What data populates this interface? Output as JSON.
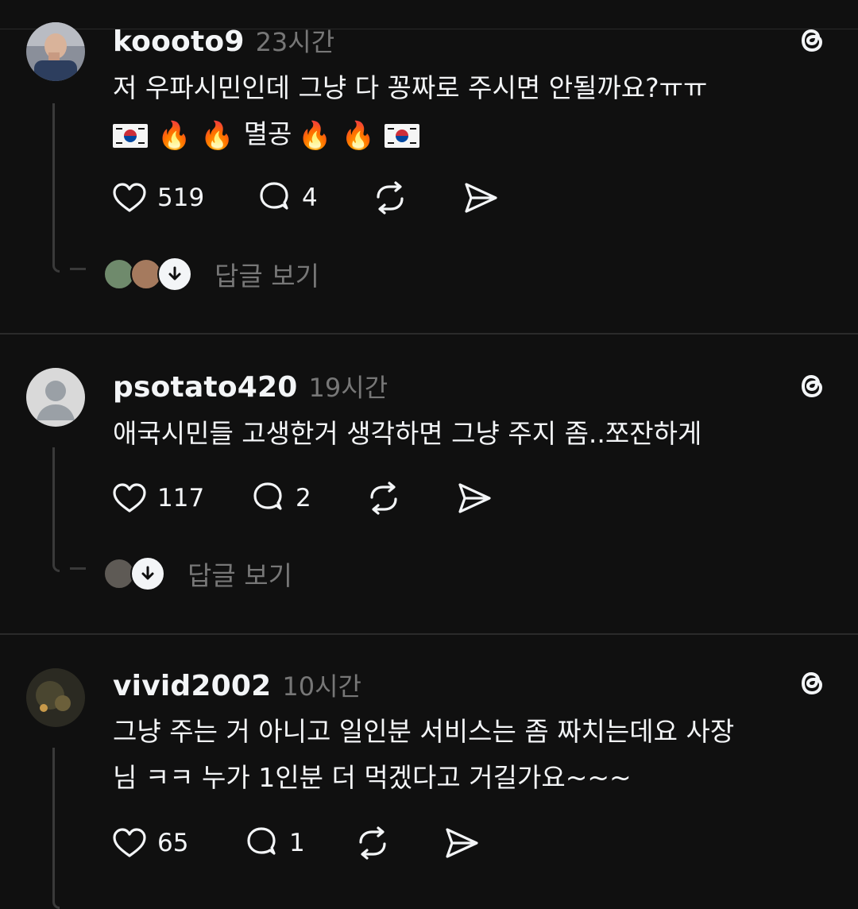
{
  "posts": [
    {
      "username": "koooto9",
      "time": "23시간",
      "text_line1": "저 우파시민인데 그냥 다 꽁짜로 주시면 안될까요?ㅠㅠ",
      "text_line2_word": "멸공",
      "likes": "519",
      "comments": "4",
      "replies_label": "답글 보기"
    },
    {
      "username": "psotato420",
      "time": "19시간",
      "text_line1": "애국시민들 고생한거 생각하면 그냥 주지 좀..쪼잔하게",
      "likes": "117",
      "comments": "2",
      "replies_label": "답글 보기"
    },
    {
      "username": "vivid2002",
      "time": "10시간",
      "text_line1": "그냥 주는 거 아니고 일인분 서비스는 좀 짜치는데요 사장",
      "text_line2": "님 ㅋㅋ 누가 1인분 더 먹겠다고 거길가요~~~",
      "likes": "65",
      "comments": "1"
    }
  ],
  "icons": {
    "like": "heart-icon",
    "comment": "comment-bubble-icon",
    "repost": "repost-icon",
    "share": "share-send-icon",
    "app_logo": "threads-logo-icon",
    "flag": "korean-flag-emoji",
    "fire": "fire-emoji",
    "expand": "arrow-down-icon"
  },
  "colors": {
    "background": "#101010",
    "text": "#f3f5f7",
    "muted": "#777777",
    "divider": "#2a2a2a"
  }
}
